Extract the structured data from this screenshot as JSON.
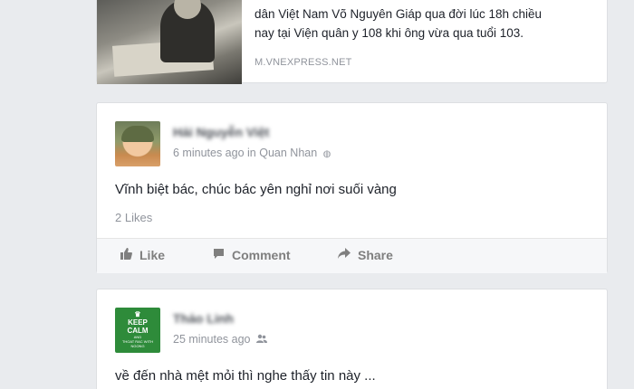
{
  "link_preview": {
    "text_line1": "dân Việt Nam Võ Nguyên Giáp qua đời lúc 18h chiều",
    "text_line2": "nay tại Viện quân y 108 khi ông vừa qua tuổi 103.",
    "source": "M.VNEXPRESS.NET"
  },
  "posts": [
    {
      "author": "Hải Nguyễn Việt",
      "time": "6 minutes ago",
      "location_prefix": "in",
      "location": "Quan Nhan",
      "privacy_icon": "globe-icon",
      "text": "Vĩnh biệt bác, chúc bác yên nghỉ nơi suối vàng",
      "likes": "2 Likes",
      "actions": {
        "like": "Like",
        "comment": "Comment",
        "share": "Share"
      }
    },
    {
      "author": "Thảo Linh",
      "time": "25 minutes ago",
      "privacy_icon": "friends-icon",
      "avatar_text": {
        "line1": "KEEP",
        "line2": "CALM",
        "line3": "AND",
        "line4": "THOAT RAC WITH",
        "line5": "NGONG"
      },
      "text": "về đến nhà mệt mỏi thì nghe thấy tin này ..."
    }
  ],
  "colors": {
    "background": "#e9ebee",
    "card": "#ffffff",
    "muted_text": "#90949c",
    "keep_calm_green": "#2e8b3a"
  }
}
